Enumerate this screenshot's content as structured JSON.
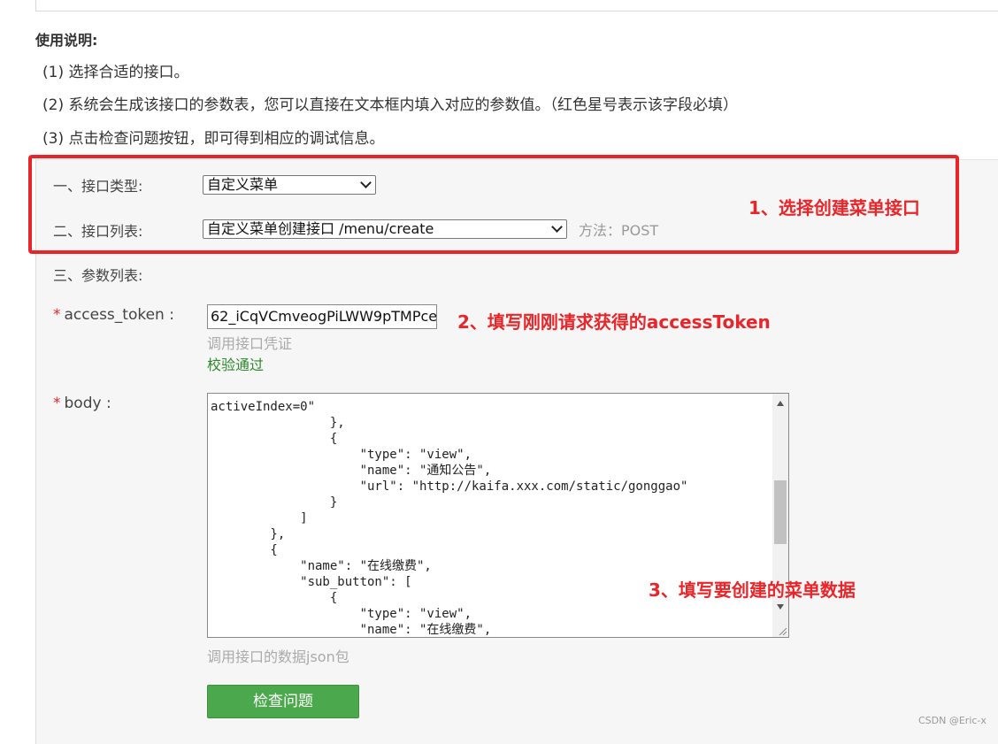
{
  "instructions": {
    "title": "使用说明:",
    "items": [
      "(1) 选择合适的接口。",
      "(2) 系统会生成该接口的参数表，您可以直接在文本框内填入对应的参数值。（红色星号表示该字段必填）",
      "(3) 点击检查问题按钮，即可得到相应的调试信息。"
    ]
  },
  "form": {
    "api_type": {
      "label": "一、接口类型:",
      "selected": "自定义菜单"
    },
    "api_list": {
      "label": "二、接口列表:",
      "selected": "自定义菜单创建接口 /menu/create",
      "method": "方法：POST"
    },
    "params_label": "三、参数列表:",
    "access_token": {
      "label": "access_token :",
      "value": "62_iCqVCmveogPiLWW9pTMPce",
      "hint": "调用接口凭证",
      "status": "校验通过"
    },
    "body": {
      "label": "body :",
      "hint": "调用接口的数据json包",
      "content": "activeIndex=0\"\n                },\n                {\n                    \"type\": \"view\",\n                    \"name\": \"通知公告\",\n                    \"url\": \"http://kaifa.xxx.com/static/gonggao\"\n                }\n            ]\n        },\n        {\n            \"name\": \"在线缴费\",\n            \"sub_button\": [\n                {\n                    \"type\": \"view\",\n                    \"name\": \"在线缴费\","
    },
    "submit_label": "检查问题"
  },
  "annotations": {
    "step1": "1、选择创建菜单接口",
    "step2": "2、填写刚刚请求获得的accessToken",
    "step3": "3、填写要创建的菜单数据"
  },
  "colors": {
    "annotation_red": "#e8262a",
    "button_green": "#4ca84c",
    "ok_green": "#2a8a2a"
  },
  "watermark": "CSDN @Eric-x"
}
